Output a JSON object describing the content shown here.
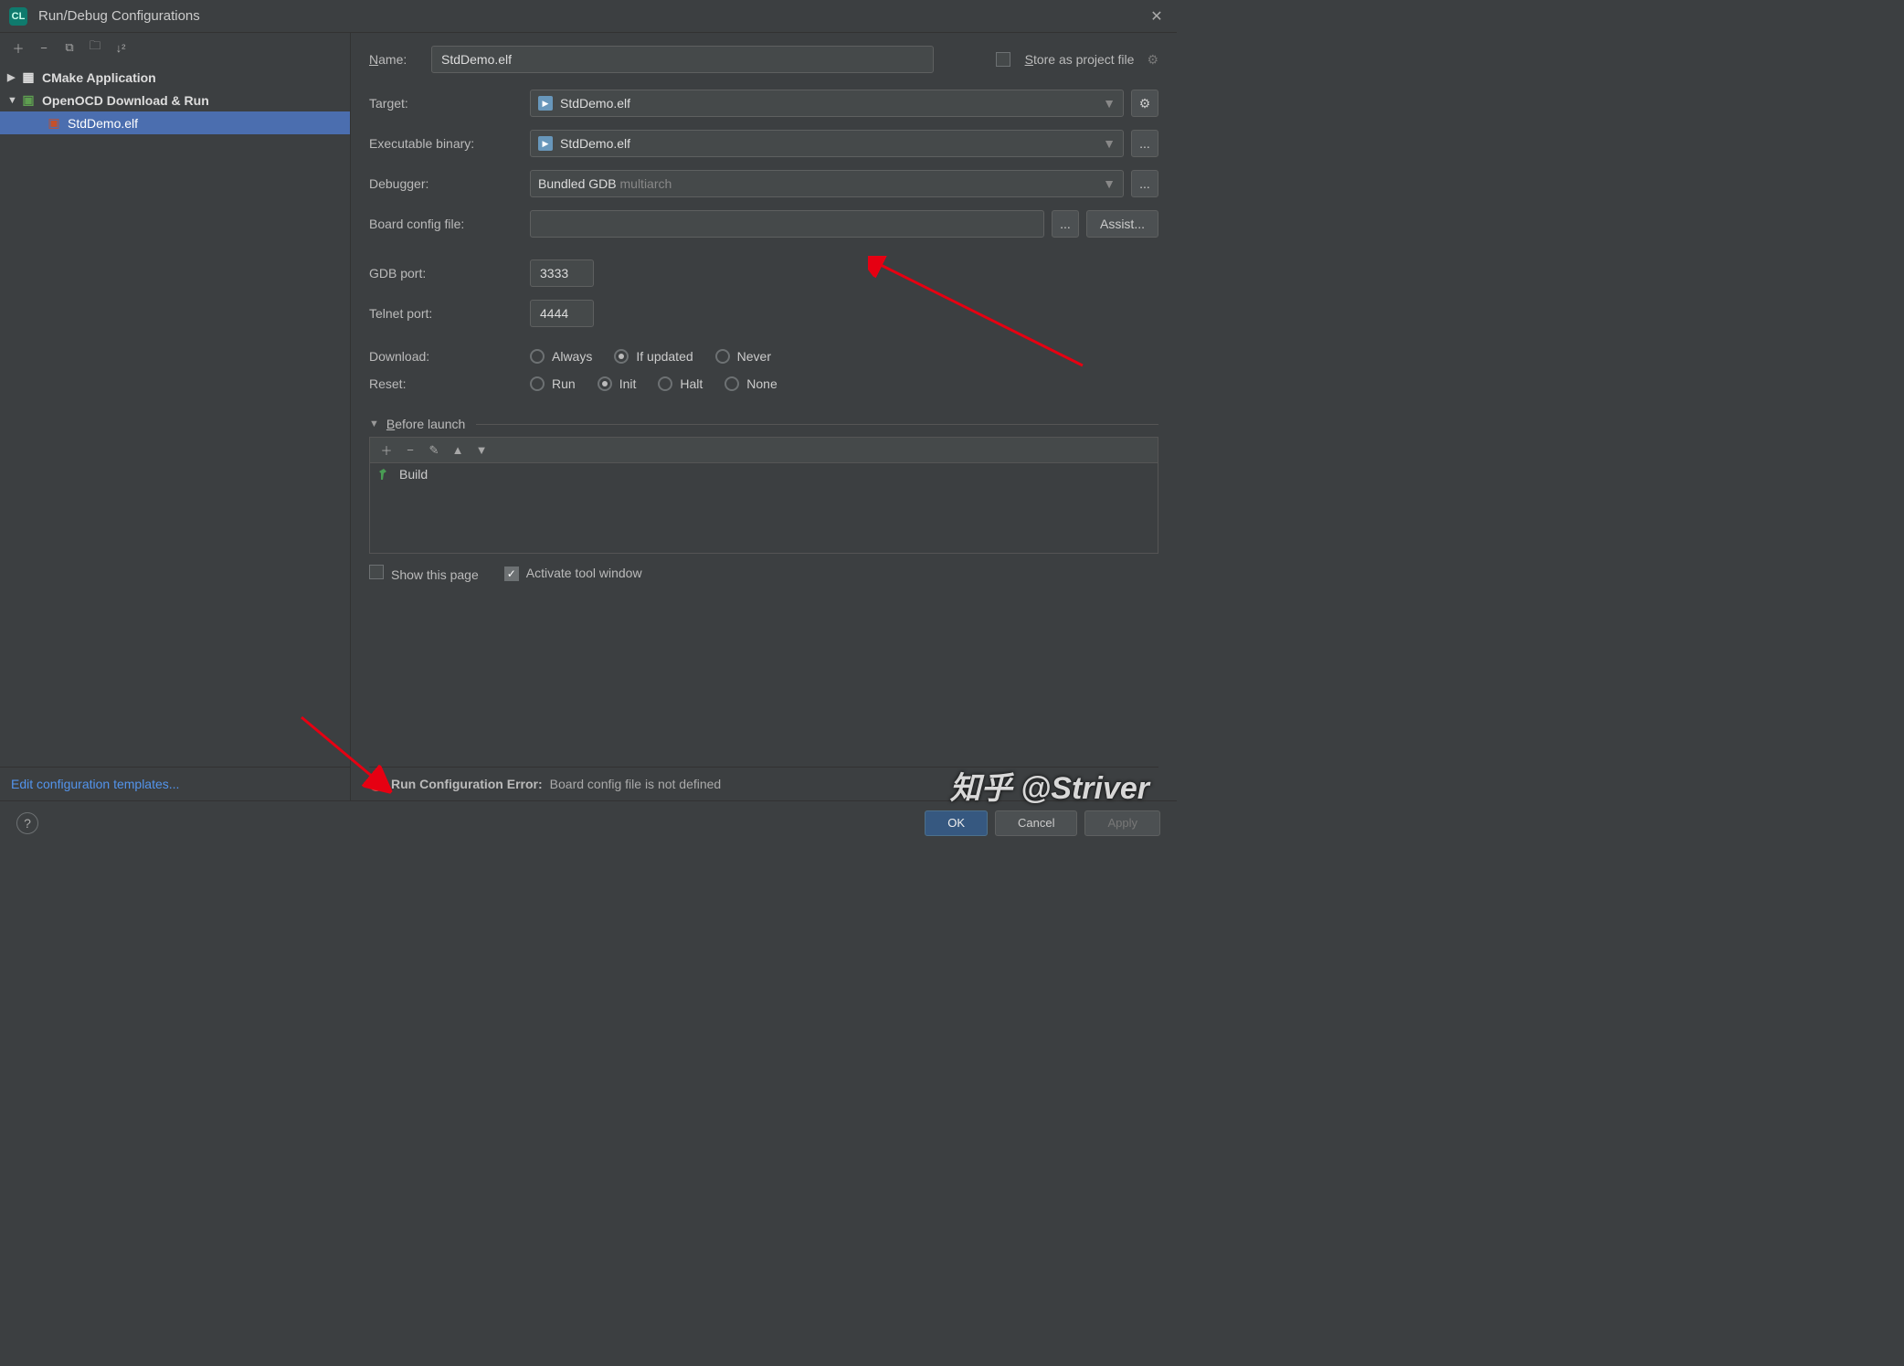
{
  "title": "Run/Debug Configurations",
  "tree": {
    "root1": "CMake Application",
    "root2": "OpenOCD Download & Run",
    "child": "StdDemo.elf"
  },
  "edit_templates": "Edit configuration templates...",
  "form": {
    "name_label_pre": "N",
    "name_label_rest": "ame:",
    "name_value": "StdDemo.elf",
    "store_pre": "S",
    "store_rest": "tore as project file",
    "target_label": "Target:",
    "target_value": "StdDemo.elf",
    "exec_label": "Executable binary:",
    "exec_value": "StdDemo.elf",
    "debugger_label": "Debugger:",
    "debugger_main": "Bundled GDB",
    "debugger_sub": "multiarch",
    "board_label": "Board config file:",
    "board_value": "",
    "assist_label": "Assist...",
    "gdb_label": "GDB port:",
    "gdb_value": "3333",
    "telnet_label": "Telnet port:",
    "telnet_value": "4444",
    "download_label": "Download:",
    "download_opts": [
      "Always",
      "If updated",
      "Never"
    ],
    "reset_label": "Reset:",
    "reset_opts": [
      "Run",
      "Init",
      "Halt",
      "None"
    ],
    "before_pre": "B",
    "before_rest": "efore launch",
    "before_item": "Build",
    "show_this_page": "Show this page",
    "activate_tool": "Activate tool window"
  },
  "error": {
    "title": "Run Configuration Error:",
    "msg": "Board config file is not defined"
  },
  "footer": {
    "ok": "OK",
    "cancel": "Cancel",
    "apply": "Apply"
  },
  "watermark": "知乎 @Striver"
}
